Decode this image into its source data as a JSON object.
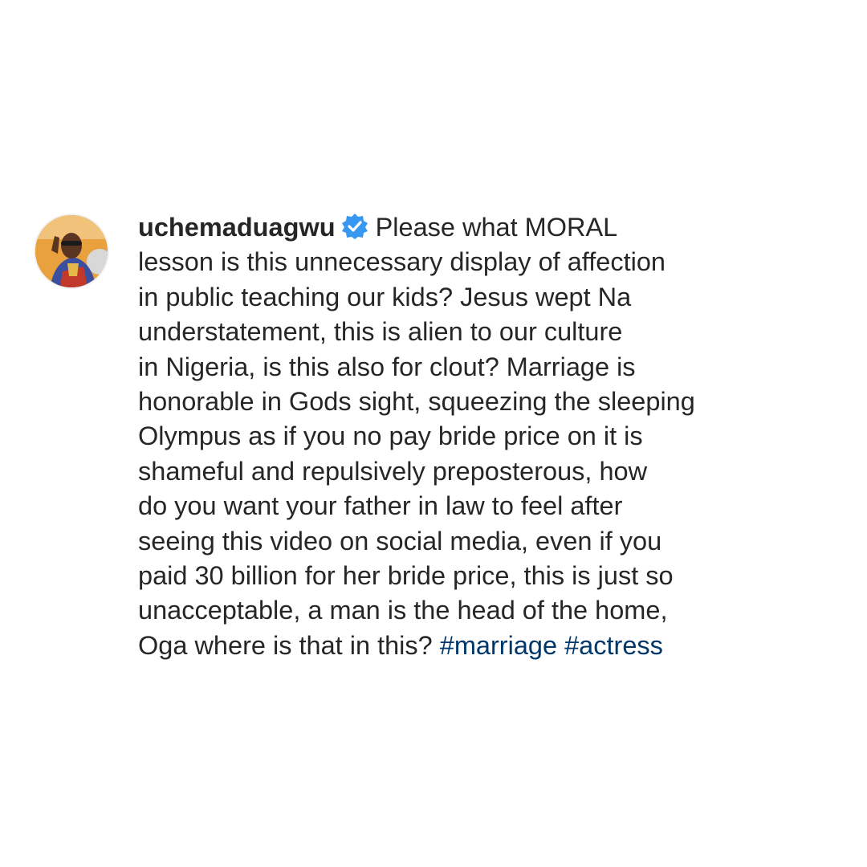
{
  "post": {
    "username": "uchemaduagwu",
    "verified_icon": "verified-badge-icon",
    "caption_lines": [
      "Please what MORAL",
      "lesson is this unnecessary display of affection",
      "in public teaching our kids? Jesus wept Na",
      "understatement, this is alien to our culture",
      "in Nigeria, is this also for clout? Marriage is",
      "honorable in Gods sight, squeezing the sleeping",
      "Olympus as if you no pay bride price on it is",
      "shameful and repulsively preposterous, how",
      "do you want your father in law to feel after",
      "seeing this video on social media, even if you",
      "paid 30 billion for her bride price, this is just so",
      "unacceptable, a man is the head of the home,",
      "Oga where is that in this? "
    ],
    "hashtags": [
      "#marriage",
      "#actress"
    ]
  },
  "colors": {
    "text": "#262626",
    "hashtag": "#00376b",
    "verified": "#3897f0",
    "background": "#ffffff"
  }
}
